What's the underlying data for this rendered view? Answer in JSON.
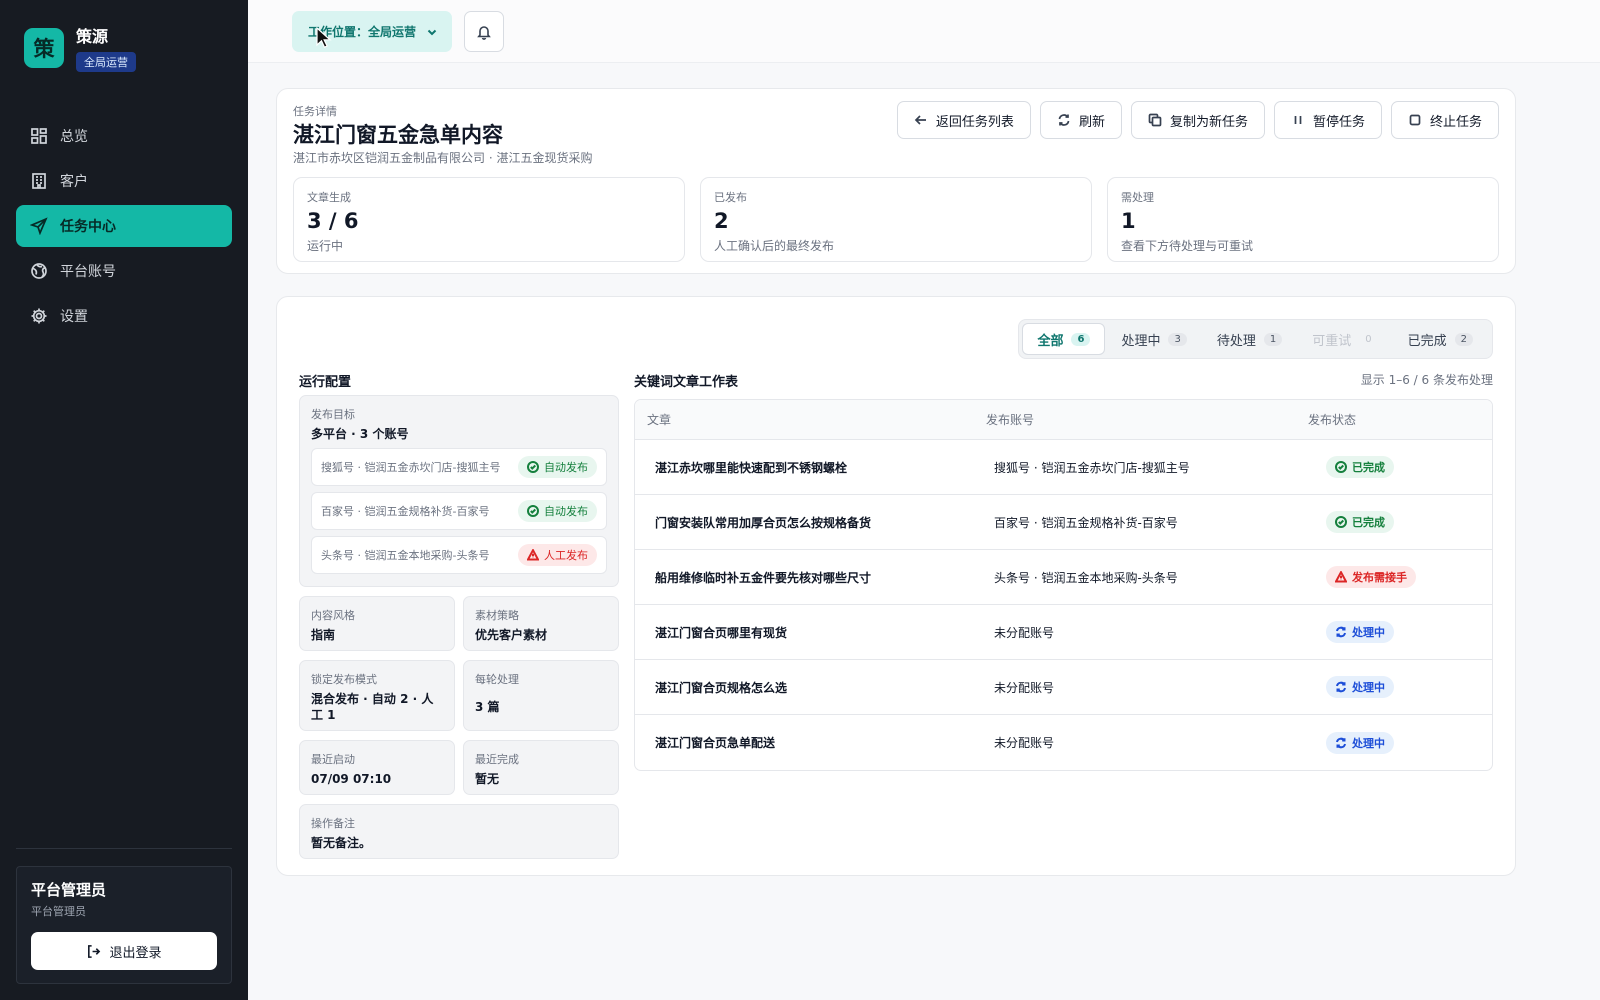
{
  "brand": {
    "logo_char": "策",
    "name": "策源",
    "badge": "全局运营"
  },
  "nav": [
    {
      "label": "总览",
      "icon": "grid-icon"
    },
    {
      "label": "客户",
      "icon": "building-icon"
    },
    {
      "label": "任务中心",
      "icon": "send-icon",
      "active": true
    },
    {
      "label": "平台账号",
      "icon": "globe-icon"
    },
    {
      "label": "设置",
      "icon": "gear-icon"
    }
  ],
  "user": {
    "name": "平台管理员",
    "role": "平台管理员",
    "logout_label": "退出登录"
  },
  "topbar": {
    "workpos_label": "工作位置：全局运营"
  },
  "header": {
    "eyebrow": "任务详情",
    "title": "湛江门窗五金急单内容",
    "subtitle": "湛江市赤坎区铠润五金制品有限公司 · 湛江五金现货采购",
    "actions": {
      "back": "返回任务列表",
      "refresh": "刷新",
      "copy": "复制为新任务",
      "pause": "暂停任务",
      "stop": "终止任务"
    },
    "stats": [
      {
        "label": "文章生成",
        "value": "3 / 6",
        "note": "运行中"
      },
      {
        "label": "已发布",
        "value": "2",
        "note": "人工确认后的最终发布"
      },
      {
        "label": "需处理",
        "value": "1",
        "note": "查看下方待处理与可重试"
      }
    ]
  },
  "filters": [
    {
      "label": "全部",
      "count": "6"
    },
    {
      "label": "处理中",
      "count": "3"
    },
    {
      "label": "待处理",
      "count": "1"
    },
    {
      "label": "可重试",
      "count": "0"
    },
    {
      "label": "已完成",
      "count": "2"
    }
  ],
  "config": {
    "title": "运行配置",
    "target_label": "发布目标",
    "target_value": "多平台 · 3 个账号",
    "accounts": [
      {
        "name": "搜狐号 · 铠润五金赤坎门店-搜狐主号",
        "mode": "自动发布"
      },
      {
        "name": "百家号 · 铠润五金规格补货-百家号",
        "mode": "自动发布"
      },
      {
        "name": "头条号 · 铠润五金本地采购-头条号",
        "mode": "人工发布"
      }
    ],
    "style_label": "内容风格",
    "style_value": "指南",
    "material_label": "素材策略",
    "material_value": "优先客户素材",
    "lockmode_label": "锁定发布模式",
    "lockmode_value": "混合发布 · 自动 2 · 人工 1",
    "perround_label": "每轮处理",
    "perround_value": "3 篇",
    "laststart_label": "最近启动",
    "laststart_value": "07/09 07:10",
    "lastdone_label": "最近完成",
    "lastdone_value": "暂无",
    "note_label": "操作备注",
    "note_value": "暂无备注。"
  },
  "table": {
    "title": "关键词文章工作表",
    "meta": "显示 1–6 / 6 条发布处理",
    "headers": {
      "article": "文章",
      "account": "发布账号",
      "status": "发布状态"
    },
    "rows": [
      {
        "article": "湛江赤坎哪里能快速配到不锈钢螺栓",
        "account": "搜狐号 · 铠润五金赤坎门店-搜狐主号",
        "status": "已完成"
      },
      {
        "article": "门窗安装队常用加厚合页怎么按规格备货",
        "account": "百家号 · 铠润五金规格补货-百家号",
        "status": "已完成"
      },
      {
        "article": "船用维修临时补五金件要先核对哪些尺寸",
        "account": "头条号 · 铠润五金本地采购-头条号",
        "status": "发布需接手"
      },
      {
        "article": "湛江门窗合页哪里有现货",
        "account": "未分配账号",
        "status": "处理中"
      },
      {
        "article": "湛江门窗合页规格怎么选",
        "account": "未分配账号",
        "status": "处理中"
      },
      {
        "article": "湛江门窗合页急单配送",
        "account": "未分配账号",
        "status": "处理中"
      }
    ]
  },
  "colors": {
    "accent": "#14b8a6",
    "sidebar_bg": "#171b22",
    "success": "#15803d",
    "danger": "#dc2626",
    "info": "#1d4ed8"
  }
}
